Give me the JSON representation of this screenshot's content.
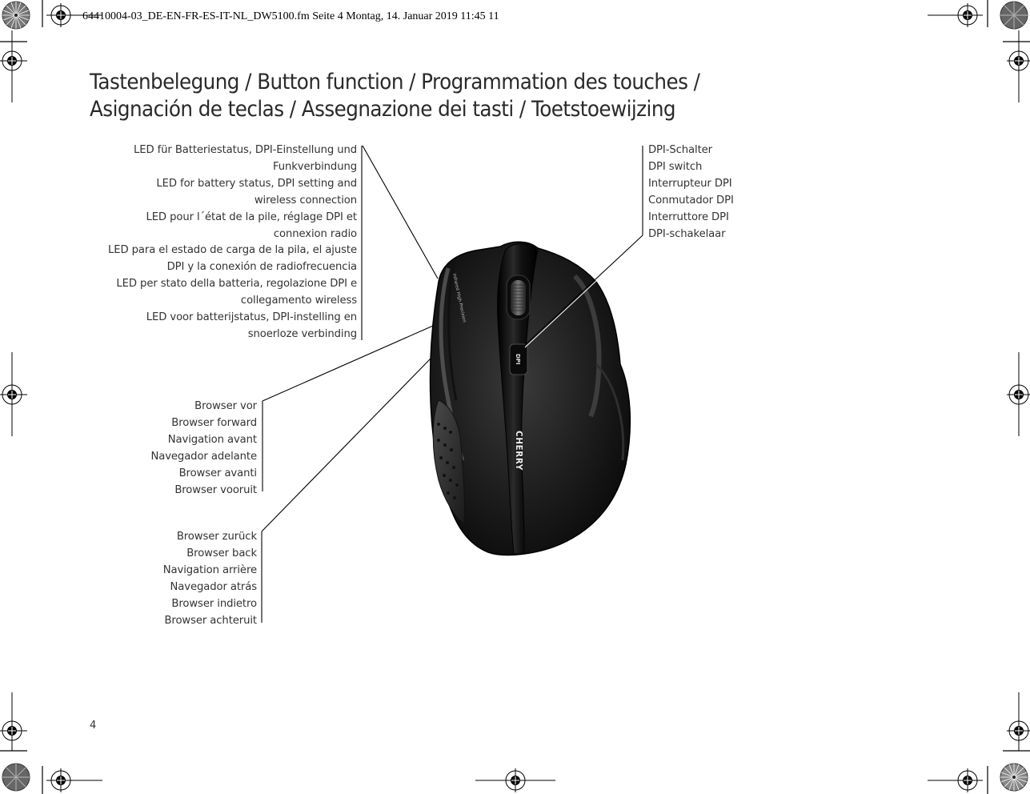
{
  "header": {
    "print_slug": "64410004-03_DE-EN-FR-ES-IT-NL_DW5100.fm  Seite 4  Montag, 14. Januar 2019  11:45 11"
  },
  "title": {
    "line1": "Tastenbelegung / Button function / Programmation des touches /",
    "line2": "Asignación de teclas / Assegnazione dei tasti / Toetstoewijzing"
  },
  "callouts": {
    "led": {
      "lines": [
        "LED für Batteriestatus, DPI-Einstellung und",
        "Funkverbindung",
        "LED for battery status, DPI setting and",
        "wireless connection",
        "LED pour l´état de la pile, réglage DPI et",
        "connexion radio",
        "LED para el estado de carga de la pila, el ajuste",
        "DPI y la conexión de radiofrecuencia",
        "LED per stato della batteria, regolazione DPI e",
        "collegamento wireless",
        "LED voor batterijstatus, DPI-instelling en",
        "snoerloze verbinding"
      ]
    },
    "dpi": {
      "lines": [
        "DPI-Schalter",
        "DPI switch",
        "Interrupteur DPI",
        "Conmutador DPI",
        "Interruttore DPI",
        "DPI-schakelaar"
      ]
    },
    "forward": {
      "lines": [
        "Browser vor",
        "Browser forward",
        "Navigation avant",
        "Navegador adelante",
        "Browser avanti",
        "Browser vooruit"
      ]
    },
    "back": {
      "lines": [
        "Browser zurück",
        "Browser back",
        "Navigation arrière",
        "Navegador atrás",
        "Browser indietro",
        "Browser achteruit"
      ]
    }
  },
  "mouse": {
    "brand_text": "CHERRY",
    "dpi_button_text": "DPI",
    "side_text": "Infrared High Precision",
    "body_color": "#151515"
  },
  "footer": {
    "page_number": "4"
  }
}
